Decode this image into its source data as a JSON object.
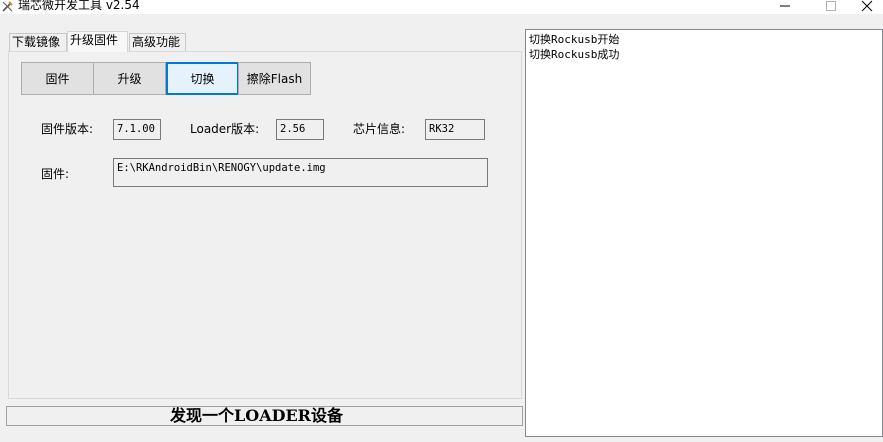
{
  "window": {
    "title": "瑞芯微开发工具 v2.54"
  },
  "tabs": [
    {
      "label": "下载镜像"
    },
    {
      "label": "升级固件"
    },
    {
      "label": "高级功能"
    }
  ],
  "actions": {
    "firmware": "固件",
    "upgrade": "升级",
    "switch": "切换",
    "erase": "擦除Flash"
  },
  "info": {
    "fw_version_label": "固件版本:",
    "fw_version_value": "7.1.00",
    "loader_label": "Loader版本:",
    "loader_value": "2.56",
    "chip_label": "芯片信息:",
    "chip_value": "RK32",
    "firmware_label": "固件:",
    "firmware_path": "E:\\RKAndroidBin\\RENOGY\\update.img"
  },
  "status": {
    "text": "发现一个LOADER设备"
  },
  "log": [
    "切换Rockusb开始",
    "切换Rockusb成功"
  ],
  "colors": {
    "focus": "#0078d7",
    "panel_bg": "#f0f0f0",
    "log_bg": "#ffffff"
  }
}
